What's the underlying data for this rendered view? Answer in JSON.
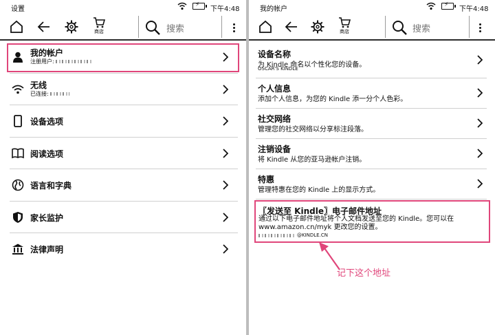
{
  "left": {
    "status": {
      "title": "设置",
      "time": "下午4:48"
    },
    "toolbar": {
      "store_label": "商店",
      "search_placeholder": "搜索"
    },
    "items": [
      {
        "label": "我的帐户",
        "sub": "注册用户: ",
        "icon": "person-icon"
      },
      {
        "label": "无线",
        "sub": "已连接: ",
        "icon": "wifi-icon"
      },
      {
        "label": "设备选项",
        "icon": "device-icon"
      },
      {
        "label": "阅读选项",
        "icon": "book-icon"
      },
      {
        "label": "语言和字典",
        "icon": "globe-icon"
      },
      {
        "label": "家长监护",
        "icon": "shield-icon"
      },
      {
        "label": "法律声明",
        "icon": "court-icon"
      }
    ]
  },
  "right": {
    "status": {
      "title": "我的帐户",
      "time": "下午4:48"
    },
    "toolbar": {
      "store_label": "商店",
      "search_placeholder": "搜索"
    },
    "items": [
      {
        "title": "设备名称",
        "desc": "为 Kindle 命名以个性化您的设备。",
        "extra": "OSCAR'S KINDLE"
      },
      {
        "title": "个人信息",
        "desc": "添加个人信息，为您的 Kindle 添一分个人色彩。"
      },
      {
        "title": "社交网络",
        "desc": "管理您的社交网络以分享标注段落。"
      },
      {
        "title": "注销设备",
        "desc": "将 Kindle 从您的亚马逊帐户注销。"
      },
      {
        "title": "特惠",
        "desc": "管理特惠在您的 Kindle 上的显示方式。"
      }
    ],
    "email": {
      "title": "〖发送至 Kindle〗电子邮件地址",
      "desc": "通过以下电子邮件地址将个人文档发送至您的 Kindle。您可以在 www.amazon.cn/myk 更改您的设置。",
      "address_suffix": "@KINDLE.CN"
    }
  },
  "annotation": {
    "text": "记下这个地址"
  },
  "colors": {
    "highlight": "#e0457a",
    "divider": "#bdbdbd"
  }
}
